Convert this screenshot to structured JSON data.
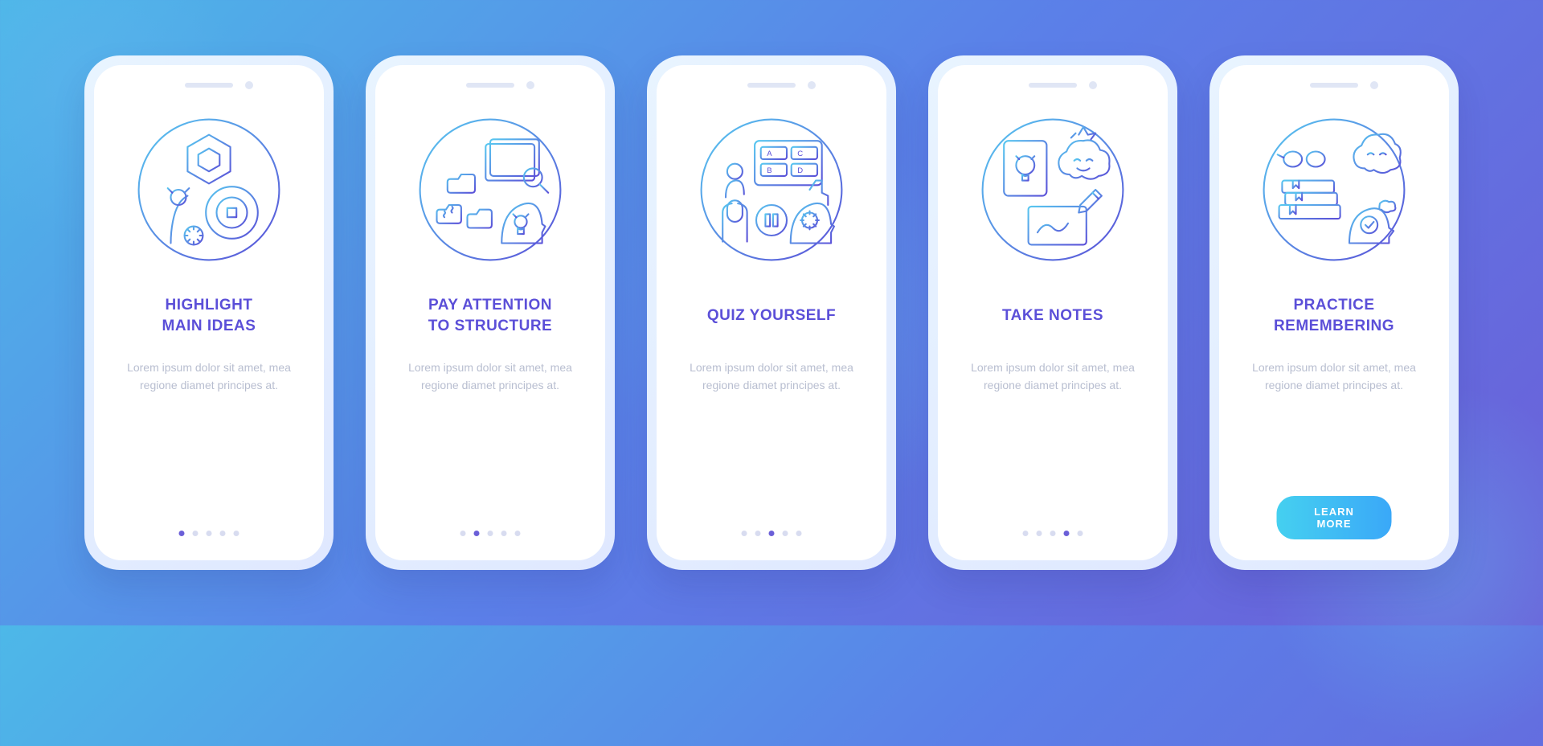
{
  "cta_label": "LEARN MORE",
  "body_text": "Lorem ipsum dolor sit amet, mea regione diamet principes at.",
  "slides": [
    {
      "title": "HIGHLIGHT\nMAIN IDEAS",
      "icon": "highlight-icon",
      "active_dot": 0
    },
    {
      "title": "PAY ATTENTION\nTO STRUCTURE",
      "icon": "structure-icon",
      "active_dot": 1
    },
    {
      "title": "QUIZ YOURSELF",
      "icon": "quiz-icon",
      "active_dot": 2
    },
    {
      "title": "TAKE NOTES",
      "icon": "notes-icon",
      "active_dot": 3
    },
    {
      "title": "PRACTICE\nREMEMBERING",
      "icon": "remember-icon",
      "active_dot": 4
    }
  ],
  "colors": {
    "stroke_light": "#58C8F0",
    "stroke_dark": "#5B4FD8"
  }
}
